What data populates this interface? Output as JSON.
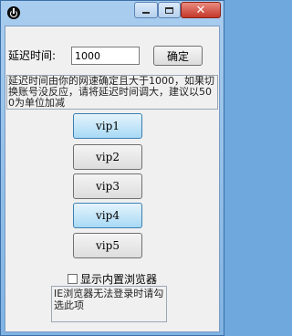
{
  "window": {
    "app_icon": "power-icon",
    "controls": {
      "minimize": "minimize-icon",
      "maximize": "maximize-icon",
      "close": "close-icon"
    }
  },
  "delay": {
    "label": "延迟时间:",
    "value": "1000",
    "confirm_label": "确定"
  },
  "notice": "延迟时间由你的网速确定且大于1000，如果切换账号没反应，请将延迟时间调大，建议以500为单位加减",
  "vip_buttons": [
    {
      "label": "vip1",
      "active": true
    },
    {
      "label": "vip2",
      "active": false
    },
    {
      "label": "vip3",
      "active": false
    },
    {
      "label": "vip4",
      "active": true
    },
    {
      "label": "vip5",
      "active": false
    }
  ],
  "browser_option": {
    "label": "显示内置浏览器",
    "checked": false,
    "tip": "IE浏览器无法登录时请勾选此项"
  },
  "colors": {
    "active_button": "#a7d9f5",
    "titlebar": "#a9cdef",
    "close": "#c4382a"
  }
}
